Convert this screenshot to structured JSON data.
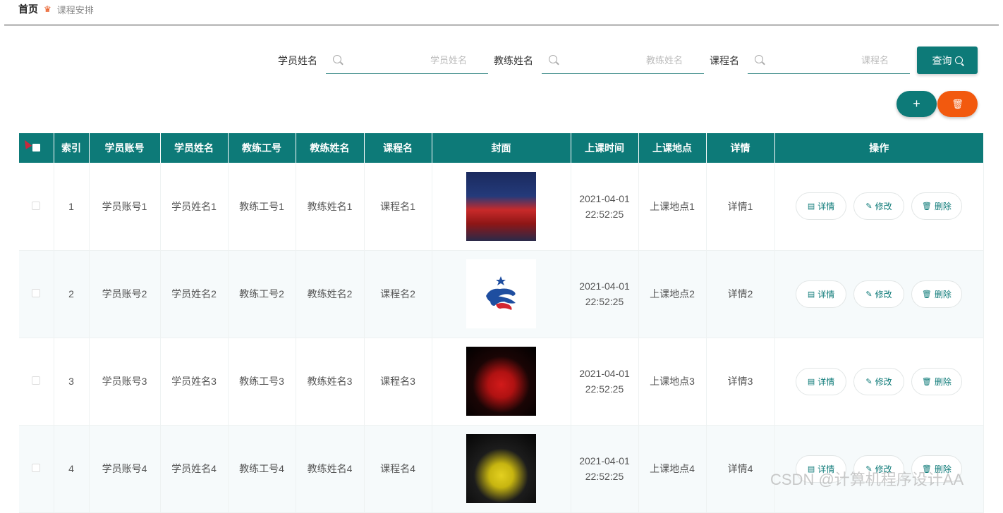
{
  "breadcrumb": {
    "home": "首页",
    "current": "课程安排"
  },
  "search": {
    "student_name_label": "学员姓名",
    "student_name_placeholder": "学员姓名",
    "coach_name_label": "教练姓名",
    "coach_name_placeholder": "教练姓名",
    "course_name_label": "课程名",
    "course_name_placeholder": "课程名",
    "query_label": "查询"
  },
  "toolbar": {
    "add_label": "+",
    "delete_icon": "trash-icon"
  },
  "colors": {
    "primary": "#0d7a78",
    "danger": "#f2590e"
  },
  "table": {
    "headers": [
      "索引",
      "学员账号",
      "学员姓名",
      "教练工号",
      "教练姓名",
      "课程名",
      "封面",
      "上课时间",
      "上课地点",
      "详情",
      "操作"
    ],
    "actions": {
      "detail": "详情",
      "edit": "修改",
      "delete": "删除"
    },
    "rows": [
      {
        "index": "1",
        "account": "学员账号1",
        "student": "学员姓名1",
        "coach_id": "教练工号1",
        "coach": "教练姓名1",
        "course": "课程名1",
        "time": "2021-04-01 22:52:25",
        "place": "上课地点1",
        "detail": "详情1"
      },
      {
        "index": "2",
        "account": "学员账号2",
        "student": "学员姓名2",
        "coach_id": "教练工号2",
        "coach": "教练姓名2",
        "course": "课程名2",
        "time": "2021-04-01 22:52:25",
        "place": "上课地点2",
        "detail": "详情2"
      },
      {
        "index": "3",
        "account": "学员账号3",
        "student": "学员姓名3",
        "coach_id": "教练工号3",
        "coach": "教练姓名3",
        "course": "课程名3",
        "time": "2021-04-01 22:52:25",
        "place": "上课地点3",
        "detail": "详情3"
      },
      {
        "index": "4",
        "account": "学员账号4",
        "student": "学员姓名4",
        "coach_id": "教练工号4",
        "coach": "教练姓名4",
        "course": "课程名4",
        "time": "2021-04-01 22:52:25",
        "place": "上课地点4",
        "detail": "详情4"
      }
    ]
  },
  "watermark": "CSDN @计算机程序设计AA"
}
